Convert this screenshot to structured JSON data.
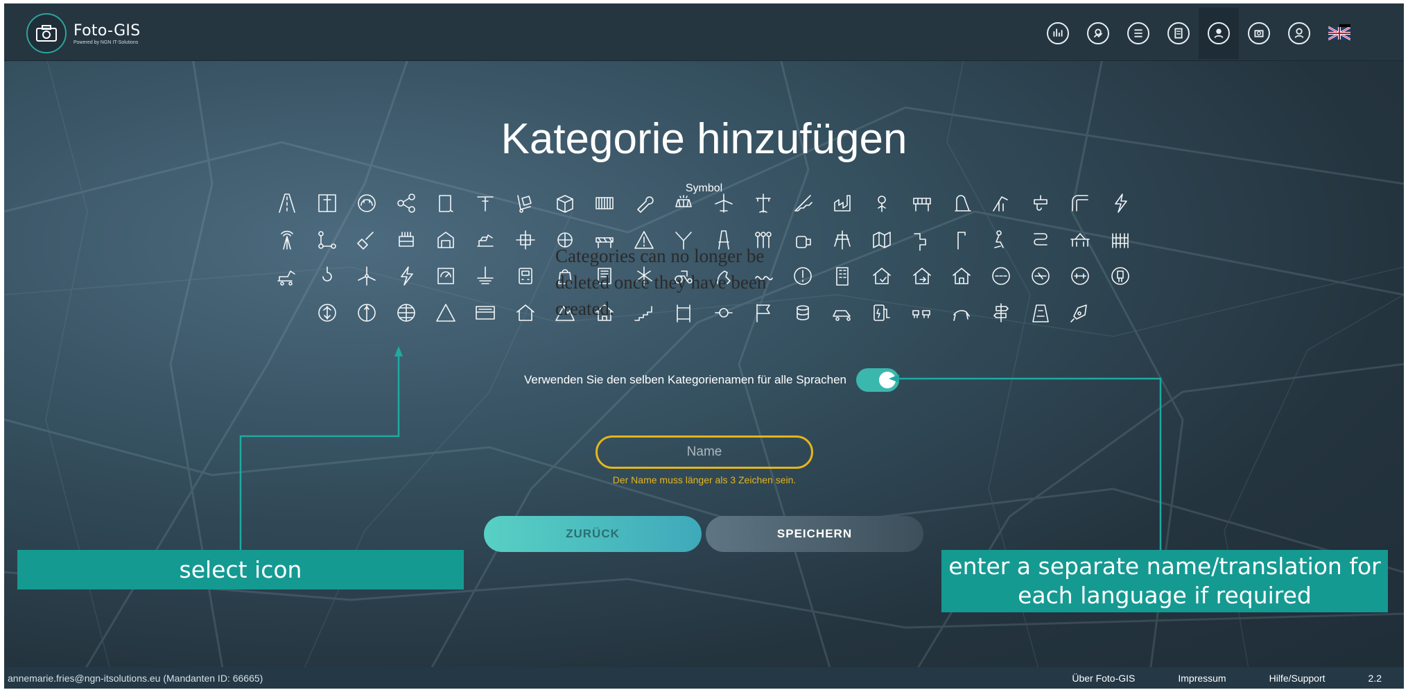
{
  "app": {
    "title": "Foto-GIS",
    "subtitle": "Powered by NGN IT-Solutions"
  },
  "nav": {
    "items": [
      {
        "name": "statistics-icon"
      },
      {
        "name": "map-photo-icon"
      },
      {
        "name": "categories-icon"
      },
      {
        "name": "tasks-icon"
      },
      {
        "name": "admin-icon"
      },
      {
        "name": "add-photo-icon"
      },
      {
        "name": "user-profile-icon"
      },
      {
        "name": "language-flag-icon"
      }
    ],
    "active_index": 4
  },
  "page": {
    "title": "Kategorie hinzufügen",
    "symbol_label": "Symbol",
    "overlay_note": "Categories can no longer be deleted once they have been created."
  },
  "symbols": [
    "road",
    "door",
    "helmet",
    "share",
    "scroll",
    "drill",
    "hand-truck",
    "box",
    "container",
    "wrench",
    "solar-panel",
    "airplane",
    "power-pole",
    "staircase",
    "factory",
    "flower",
    "bridge",
    "playground",
    "scaffold",
    "water-tap",
    "pipe",
    "lightning",
    "antenna",
    "network",
    "shovel",
    "transformer",
    "garage",
    "excavator",
    "junction",
    "fan",
    "barrier",
    "warning",
    "slope",
    "transmission-tower",
    "valves",
    "tank",
    "pylon",
    "map",
    "tetris",
    "streetlight",
    "worker",
    "curve",
    "pier",
    "fence",
    "bulldozer",
    "crane-hook",
    "wind-turbine",
    "bolt",
    "meter",
    "ground",
    "device",
    "bag",
    "panel",
    "power-line",
    "tractor",
    "horse",
    "snake",
    "circle",
    "building",
    "house-check",
    "house-arrow",
    "house",
    "pipe-a",
    "pipe-b",
    "pipe-c",
    "valve-box",
    "tree",
    "hydrant",
    "globe",
    "triangle",
    "bus-stop",
    "house-small",
    "mountain",
    "house-outline",
    "stairs-up",
    "gate",
    "lock",
    "flag",
    "cable-reel",
    "car",
    "charging",
    "cows",
    "bull",
    "signpost",
    "hazard",
    "rocket"
  ],
  "toggle": {
    "label": "Verwenden Sie den selben Kategorienamen für alle Sprachen",
    "on": true
  },
  "name_field": {
    "placeholder": "Name",
    "value": "",
    "error": "Der Name muss länger als 3 Zeichen sein."
  },
  "buttons": {
    "back": "ZURÜCK",
    "save": "SPEICHERN"
  },
  "callouts": {
    "left": "select icon",
    "right": "enter a separate name/translation for each language if required"
  },
  "footer": {
    "user": "annemarie.fries@ngn-itsolutions.eu (Mandanten ID: 66665)",
    "links": [
      "Über Foto-GIS",
      "Impressum",
      "Hilfe/Support",
      "2.2"
    ]
  },
  "colors": {
    "accent": "#3bb8ad",
    "warning": "#e5b51b",
    "callout": "#159a92",
    "topbar": "#253641"
  }
}
